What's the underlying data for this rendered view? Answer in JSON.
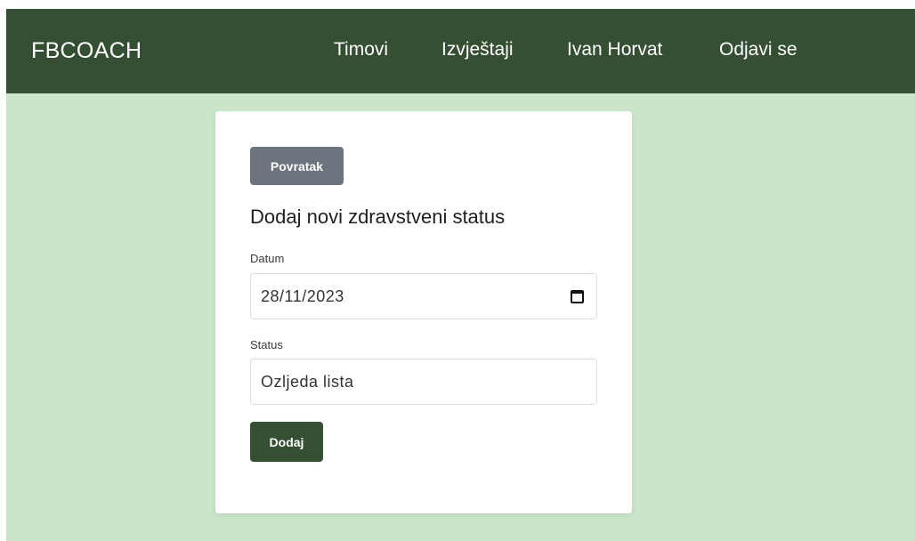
{
  "navbar": {
    "brand": "FBCOACH",
    "links": {
      "teams": "Timovi",
      "reports": "Izvještaji",
      "user": "Ivan Horvat",
      "logout": "Odjavi se"
    }
  },
  "form": {
    "back_label": "Povratak",
    "title": "Dodaj novi zdravstveni status",
    "date": {
      "label": "Datum",
      "value": "28/11/2023",
      "icon": "calendar-icon"
    },
    "status": {
      "label": "Status",
      "value": "Ozljeda lista"
    },
    "submit_label": "Dodaj"
  },
  "colors": {
    "navbar": "#354f33",
    "page_background": "#c9e6c9",
    "back_button": "#6c757d",
    "submit_button": "#354f33"
  }
}
